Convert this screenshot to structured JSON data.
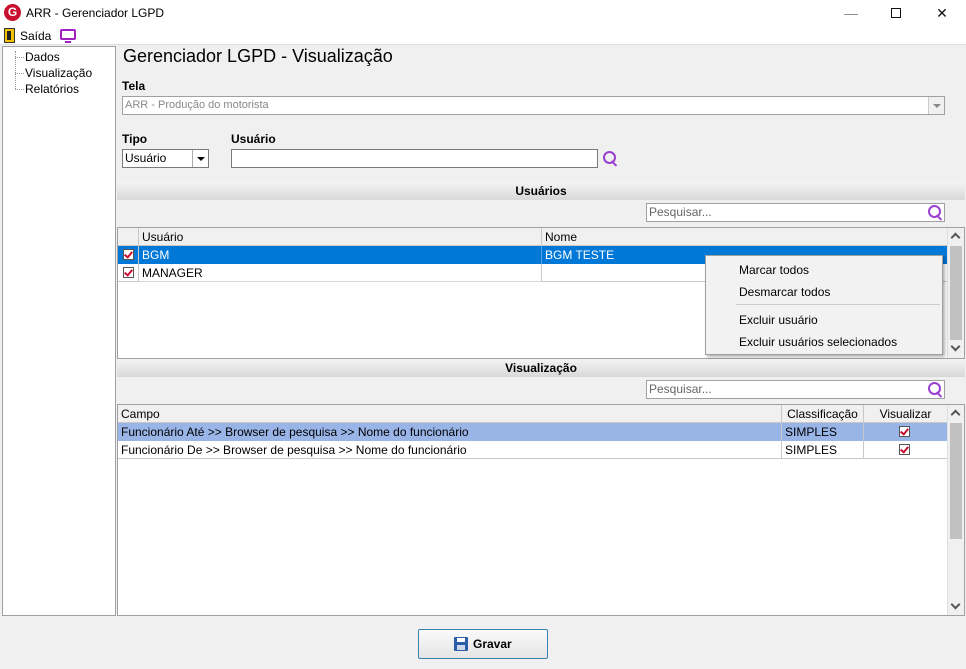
{
  "window": {
    "logo": "G",
    "title": "ARR - Gerenciador LGPD",
    "minimize_glyph": "—",
    "close_glyph": "✕"
  },
  "menubar": {
    "exit_label": "Saída"
  },
  "sidebar": {
    "items": [
      {
        "label": "Dados"
      },
      {
        "label": "Visualização"
      },
      {
        "label": "Relatórios"
      }
    ]
  },
  "page_title": "Gerenciador LGPD - Visualização",
  "tela": {
    "label": "Tela",
    "value": "ARR - Produção do motorista"
  },
  "tipo": {
    "label": "Tipo",
    "value": "Usuário"
  },
  "usuario": {
    "label": "Usuário",
    "value": ""
  },
  "usuarios_section": {
    "title": "Usuários",
    "search_placeholder": "Pesquisar...",
    "columns": [
      "Usuário",
      "Nome"
    ],
    "rows": [
      {
        "usuario": "BGM",
        "nome": "BGM TESTE",
        "checked": true,
        "selected": true
      },
      {
        "usuario": "MANAGER",
        "nome": "",
        "checked": true,
        "selected": false
      }
    ]
  },
  "context_menu": {
    "items": [
      "Marcar todos",
      "Desmarcar todos",
      "Excluir usuário",
      "Excluir usuários selecionados"
    ]
  },
  "visualizacao_section": {
    "title": "Visualização",
    "search_placeholder": "Pesquisar...",
    "columns": [
      "Campo",
      "Classificação",
      "Visualizar"
    ],
    "rows": [
      {
        "campo": "Funcionário Até >> Browser de pesquisa >> Nome do funcionário",
        "classificacao": "SIMPLES",
        "visualizar": true,
        "selected": true
      },
      {
        "campo": "Funcionário De >> Browser de pesquisa >> Nome do funcionário",
        "classificacao": "SIMPLES",
        "visualizar": true,
        "selected": false
      }
    ]
  },
  "buttons": {
    "save_label": "Gravar"
  },
  "colors": {
    "selection_blue": "#0078d7",
    "selection_light": "#99b4e6",
    "accent_red": "#c8102e",
    "search_purple": "#9b3fd0"
  }
}
